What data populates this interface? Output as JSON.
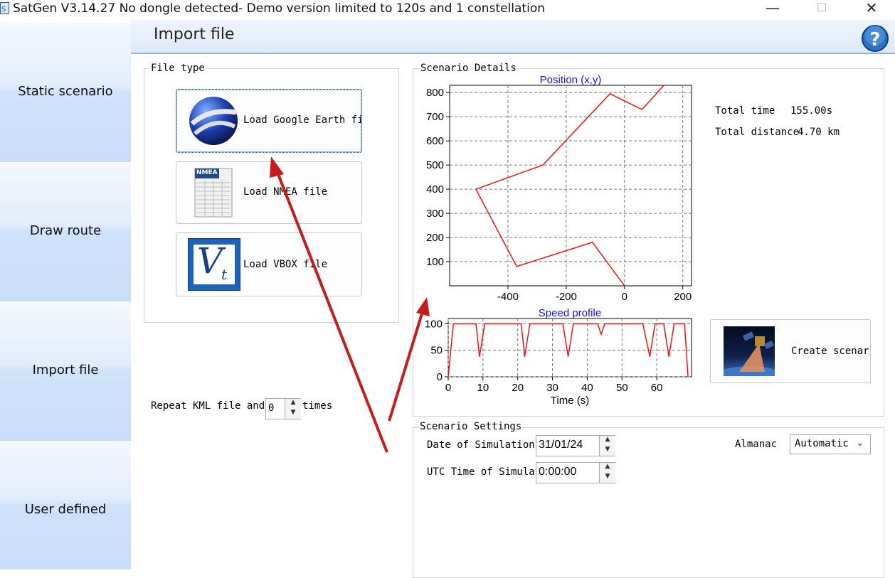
{
  "window": {
    "title": "SatGen V3.14.27 No dongle detected- Demo version limited to 120s and 1 constellation",
    "minimize": "—",
    "maximize": "☐",
    "close": "✕"
  },
  "nav": [
    {
      "label": "Static scenario"
    },
    {
      "label": "Draw route"
    },
    {
      "label": "Import file"
    },
    {
      "label": "User defined"
    }
  ],
  "header": {
    "title": "Import file",
    "help_icon": "question-icon"
  },
  "file_type": {
    "label": "File type",
    "buttons": [
      {
        "label": "Load Google Earth file",
        "icon": "google-earth-icon"
      },
      {
        "label": "Load NMEA file",
        "icon": "nmea-file-icon",
        "icon_text": "NMEA"
      },
      {
        "label": "Load VBOX file",
        "icon": "vbox-icon",
        "icon_text": "V",
        "icon_sub": "t"
      }
    ]
  },
  "repeat": {
    "label_before": "Repeat KML file and",
    "value": "0",
    "label_after": "times"
  },
  "scenario_details": {
    "label": "Scenario Details",
    "total_time_label": "Total time",
    "total_time_value": "155.00s",
    "total_distance_label": "Total distance",
    "total_distance_value": "4.70 km",
    "create_button": "Create scenario"
  },
  "scenario_settings": {
    "label": "Scenario Settings",
    "date_label": "Date of Simulation",
    "date_value": "31/01/24",
    "time_label": "UTC Time of Simulation",
    "time_value": "0:00:00",
    "almanac_label": "Almanac",
    "almanac_value": "Automatic"
  },
  "chart_data": [
    {
      "type": "line",
      "title": "Position (x,y)",
      "xlabel": "",
      "ylabel": "",
      "xlim": [
        -600,
        230
      ],
      "ylim": [
        0,
        830
      ],
      "xticks": [
        -400,
        -200,
        0,
        200
      ],
      "yticks": [
        100,
        200,
        300,
        400,
        500,
        600,
        700,
        800
      ],
      "grid": true,
      "color": "#ff0000",
      "x": [
        0,
        -110,
        -370,
        -510,
        -280,
        -50,
        60,
        135
      ],
      "y": [
        0,
        180,
        80,
        400,
        500,
        795,
        730,
        830
      ]
    },
    {
      "type": "line",
      "title": "Speed profile",
      "xlabel": "Time (s)",
      "ylabel": "",
      "xlim": [
        0,
        70
      ],
      "ylim": [
        0,
        110
      ],
      "xticks": [
        0,
        10,
        20,
        30,
        40,
        50,
        60
      ],
      "yticks": [
        0,
        50,
        100
      ],
      "grid": true,
      "color": "#ff0000",
      "x": [
        0,
        1.5,
        8,
        9,
        10.5,
        21,
        22,
        23.5,
        33,
        34.5,
        36,
        43,
        44,
        45,
        56,
        58,
        59.5,
        62,
        63.5,
        65,
        68,
        69
      ],
      "y": [
        0,
        100,
        100,
        38,
        100,
        100,
        38,
        100,
        100,
        38,
        100,
        100,
        80,
        100,
        100,
        38,
        100,
        100,
        38,
        100,
        100,
        0
      ]
    }
  ]
}
